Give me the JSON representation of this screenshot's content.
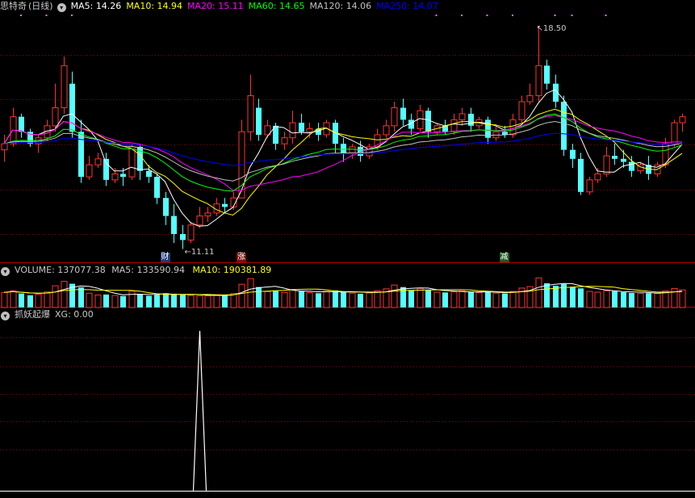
{
  "main_panel": {
    "title": "思特奇",
    "period": "(日线)",
    "ma_labels": [
      {
        "name": "MA5",
        "value": "14.26",
        "color": "#ffffff"
      },
      {
        "name": "MA10",
        "value": "14.94",
        "color": "#ffff00"
      },
      {
        "name": "MA20",
        "value": "15.11",
        "color": "#ff00ff"
      },
      {
        "name": "MA60",
        "value": "14.65",
        "color": "#00ff00"
      },
      {
        "name": "MA120",
        "value": "14.06",
        "color": "#c0c0c0"
      },
      {
        "name": "MA250",
        "value": "14.07",
        "color": "#0000ff"
      }
    ],
    "high_label": "18.50",
    "low_label": "11.11",
    "markers": [
      {
        "text": "财",
        "index": 19,
        "bg": "#1e3c7a"
      },
      {
        "text": "涨",
        "index": 28,
        "bg": "#7a1010"
      },
      {
        "text": "减",
        "index": 59,
        "bg": "#1b5a1b"
      }
    ]
  },
  "volume_panel": {
    "title": "VOLUME",
    "value": "137077.38",
    "ma5_label": "MA5",
    "ma5_value": "133590.94",
    "ma10_label": "MA10",
    "ma10_value": "190381.89"
  },
  "indicator_panel": {
    "title": "抓妖起爆",
    "xg_label": "XG",
    "xg_value": "0.00"
  },
  "colors": {
    "up": "#ff3232",
    "down": "#54ffff",
    "grid": "#8b0000",
    "panel_border": "#b00000"
  },
  "chart_data": [
    {
      "type": "candlestick",
      "title": "思特奇 (日线)",
      "ylim": [
        10.9,
        18.9
      ],
      "candles": [
        [
          14.4,
          14.9,
          14.6,
          14.0
        ],
        [
          14.6,
          15.8,
          15.5,
          14.5
        ],
        [
          15.5,
          15.6,
          15.0,
          14.8
        ],
        [
          15.0,
          15.1,
          14.6,
          14.5
        ],
        [
          14.6,
          14.9,
          14.8,
          14.3
        ],
        [
          14.8,
          15.4,
          15.2,
          14.7
        ],
        [
          15.2,
          16.6,
          15.8,
          15.0
        ],
        [
          15.8,
          17.5,
          17.2,
          15.6
        ],
        [
          16.6,
          17.0,
          15.0,
          14.8
        ],
        [
          15.0,
          15.4,
          13.5,
          13.3
        ],
        [
          13.5,
          14.2,
          13.9,
          13.4
        ],
        [
          13.9,
          14.3,
          14.1,
          13.8
        ],
        [
          14.1,
          14.3,
          13.4,
          13.2
        ],
        [
          13.4,
          13.8,
          13.6,
          13.3
        ],
        [
          13.6,
          13.8,
          13.5,
          13.2
        ],
        [
          13.5,
          14.6,
          14.5,
          13.4
        ],
        [
          14.5,
          14.6,
          13.7,
          13.4
        ],
        [
          13.7,
          13.9,
          13.5,
          13.3
        ],
        [
          13.5,
          13.6,
          12.8,
          12.6
        ],
        [
          12.8,
          13.0,
          12.2,
          11.9
        ],
        [
          12.2,
          12.6,
          11.6,
          11.3
        ],
        [
          11.6,
          11.9,
          11.4,
          11.1
        ],
        [
          11.4,
          12.0,
          11.9,
          11.3
        ],
        [
          11.9,
          12.5,
          12.2,
          11.8
        ],
        [
          12.2,
          12.5,
          12.3,
          12.0
        ],
        [
          12.3,
          12.8,
          12.6,
          12.2
        ],
        [
          12.6,
          12.8,
          12.5,
          12.3
        ],
        [
          12.5,
          13.0,
          12.8,
          12.4
        ],
        [
          12.8,
          15.4,
          15.0,
          12.8
        ],
        [
          15.0,
          16.9,
          16.2,
          14.7
        ],
        [
          15.8,
          16.1,
          14.9,
          14.7
        ],
        [
          14.9,
          15.4,
          15.2,
          14.8
        ],
        [
          15.2,
          15.3,
          14.6,
          14.4
        ],
        [
          14.6,
          15.0,
          14.8,
          14.4
        ],
        [
          14.8,
          15.7,
          15.3,
          14.6
        ],
        [
          15.3,
          15.6,
          15.0,
          14.9
        ],
        [
          15.0,
          15.3,
          15.1,
          14.8
        ],
        [
          15.1,
          15.3,
          14.9,
          14.7
        ],
        [
          14.9,
          15.4,
          15.3,
          14.8
        ],
        [
          15.3,
          15.4,
          14.6,
          14.3
        ],
        [
          14.6,
          14.8,
          14.3,
          14.0
        ],
        [
          14.3,
          14.6,
          14.5,
          14.1
        ],
        [
          14.5,
          14.7,
          14.2,
          14.0
        ],
        [
          14.2,
          14.6,
          14.5,
          14.1
        ],
        [
          14.5,
          15.1,
          14.9,
          14.4
        ],
        [
          14.9,
          15.4,
          15.2,
          14.8
        ],
        [
          15.2,
          16.0,
          15.8,
          15.0
        ],
        [
          15.8,
          16.1,
          15.4,
          15.2
        ],
        [
          15.4,
          15.6,
          15.1,
          14.9
        ],
        [
          15.1,
          15.9,
          15.7,
          15.0
        ],
        [
          15.7,
          15.8,
          15.0,
          14.8
        ],
        [
          15.0,
          15.3,
          15.2,
          14.9
        ],
        [
          15.2,
          15.4,
          15.0,
          14.9
        ],
        [
          15.0,
          15.6,
          15.4,
          14.9
        ],
        [
          15.4,
          15.8,
          15.6,
          15.2
        ],
        [
          15.6,
          15.8,
          15.2,
          15.0
        ],
        [
          15.2,
          15.5,
          15.4,
          15.1
        ],
        [
          15.4,
          15.5,
          14.8,
          14.6
        ],
        [
          14.8,
          15.2,
          15.0,
          14.7
        ],
        [
          15.0,
          15.2,
          14.9,
          14.8
        ],
        [
          14.9,
          15.6,
          15.4,
          14.8
        ],
        [
          15.4,
          16.2,
          16.0,
          15.3
        ],
        [
          16.0,
          16.6,
          16.2,
          15.9
        ],
        [
          16.2,
          18.5,
          17.2,
          16.0
        ],
        [
          17.2,
          17.4,
          16.6,
          16.4
        ],
        [
          16.6,
          16.9,
          16.0,
          15.8
        ],
        [
          16.0,
          16.2,
          14.4,
          14.2
        ],
        [
          14.4,
          14.6,
          14.1,
          13.8
        ],
        [
          14.1,
          14.3,
          13.0,
          12.9
        ],
        [
          13.0,
          13.5,
          13.4,
          12.9
        ],
        [
          13.4,
          13.8,
          13.6,
          13.3
        ],
        [
          13.6,
          14.5,
          14.2,
          13.5
        ],
        [
          14.2,
          14.6,
          14.1,
          13.9
        ],
        [
          14.1,
          14.4,
          14.0,
          13.8
        ],
        [
          14.0,
          14.2,
          13.7,
          13.5
        ],
        [
          13.7,
          14.0,
          13.9,
          13.6
        ],
        [
          13.9,
          14.2,
          13.6,
          13.4
        ],
        [
          13.6,
          14.0,
          13.9,
          13.5
        ],
        [
          13.9,
          14.8,
          14.6,
          13.8
        ],
        [
          14.6,
          15.4,
          15.3,
          14.5
        ],
        [
          15.3,
          15.6,
          15.5,
          15.0
        ]
      ],
      "volume": [
        118000,
        132000,
        110000,
        96000,
        104000,
        122000,
        170000,
        205000,
        186000,
        158000,
        112000,
        98000,
        102000,
        94000,
        90000,
        128000,
        106000,
        92000,
        100000,
        112000,
        108000,
        98000,
        94000,
        92000,
        91000,
        100000,
        97000,
        110000,
        182000,
        226000,
        160000,
        124000,
        134000,
        118000,
        142000,
        128000,
        116000,
        112000,
        126000,
        134000,
        122000,
        112000,
        108000,
        114000,
        132000,
        146000,
        176000,
        160000,
        136000,
        150000,
        138000,
        120000,
        118000,
        122000,
        130000,
        124000,
        116000,
        122000,
        112000,
        110000,
        126000,
        152000,
        164000,
        232000,
        190000,
        170000,
        184000,
        160000,
        150000,
        126000,
        120000,
        132000,
        128000,
        120000,
        114000,
        110000,
        112000,
        110000,
        130000,
        148000,
        138000
      ],
      "volume_ylim": [
        0,
        240000
      ],
      "indicator": {
        "name": "XG",
        "signal_index": 23,
        "signal_value": 1,
        "ylim": [
          0,
          1.06
        ]
      }
    }
  ]
}
